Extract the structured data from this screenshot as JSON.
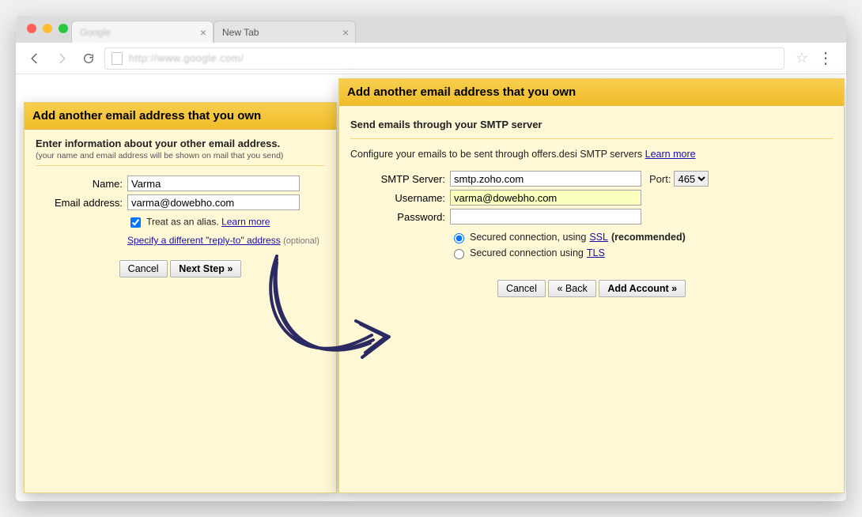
{
  "tabs": [
    {
      "title": "Google"
    },
    {
      "title": "New Tab"
    }
  ],
  "omnibox": {
    "url": "http://www.google.com/"
  },
  "panel1": {
    "header": "Add another email address that you own",
    "subtitle": "Enter information about your other email address.",
    "subnote": "(your name and email address will be shown on mail that you send)",
    "name_label": "Name:",
    "name_value": "Varma",
    "email_label": "Email address:",
    "email_value": "varma@dowebho.com",
    "alias_label": "Treat as an alias.",
    "alias_learn": "Learn more",
    "replyto_link": "Specify a different \"reply-to\" address",
    "replyto_optional": "(optional)",
    "cancel": "Cancel",
    "next": "Next Step »"
  },
  "panel2": {
    "header": "Add another email address that you own",
    "subheader": "Send emails through your SMTP server",
    "config_text": "Configure your emails to be sent through offers.desi SMTP servers",
    "config_learn": "Learn more",
    "smtp_label": "SMTP Server:",
    "smtp_value": "smtp.zoho.com",
    "port_label": "Port:",
    "port_value": "465",
    "user_label": "Username:",
    "user_value": "varma@dowebho.com",
    "pass_label": "Password:",
    "pass_value": "",
    "ssl_label_pre": "Secured connection, using ",
    "ssl_link": "SSL",
    "ssl_label_post": " (recommended)",
    "tls_label_pre": "Secured connection using ",
    "tls_link": "TLS",
    "cancel": "Cancel",
    "back": "« Back",
    "add": "Add Account »"
  }
}
